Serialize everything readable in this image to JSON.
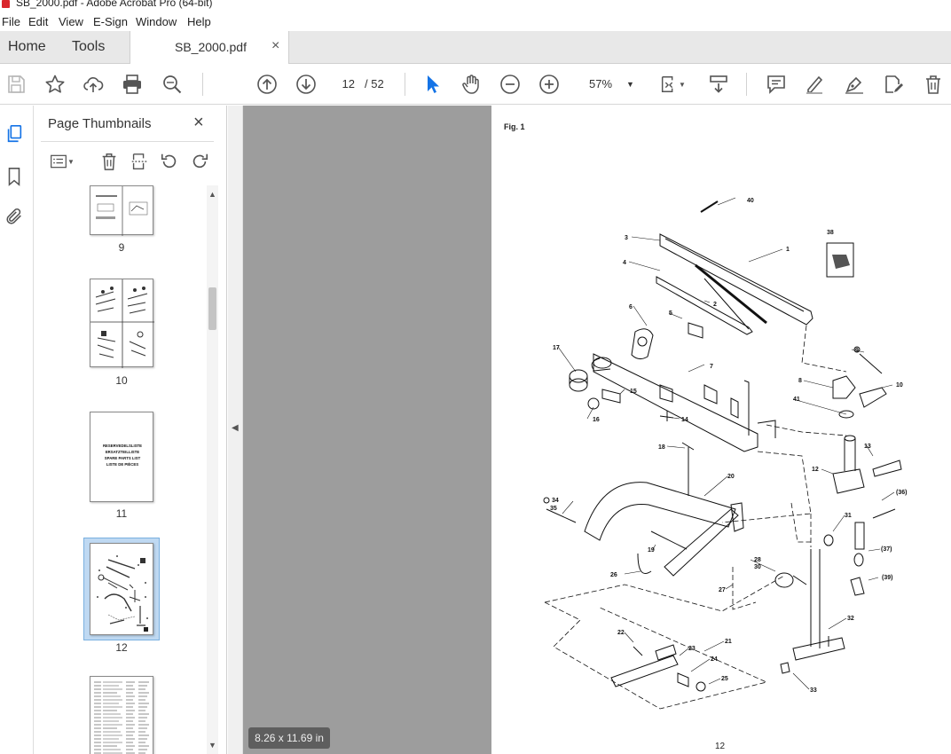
{
  "window": {
    "title": "SB_2000.pdf - Adobe Acrobat Pro (64-bit)"
  },
  "menu": [
    "File",
    "Edit",
    "View",
    "E-Sign",
    "Window",
    "Help"
  ],
  "tabs": {
    "home": "Home",
    "tools": "Tools",
    "document": "SB_2000.pdf",
    "close": "×"
  },
  "toolbar": {
    "current_page": "12",
    "page_total": "/  52",
    "zoom": "57%"
  },
  "thumbnails": {
    "panel_title": "Page Thumbnails",
    "close": "×",
    "pages": [
      {
        "label": "9"
      },
      {
        "label": "10"
      },
      {
        "label": "11",
        "lines": [
          "RESERVEDELSLISTE",
          "ERSATZTEILLISTE",
          "SPARE PARTS LIST",
          "LISTE DE PIÈCES"
        ]
      },
      {
        "label": "12",
        "selected": true
      },
      {
        "label": ""
      }
    ]
  },
  "status": {
    "page_size": "8.26 x 11.69 in"
  },
  "document": {
    "figure_label": "Fig. 1",
    "page_number": "12",
    "callouts": [
      "40",
      "3",
      "1",
      "38",
      "4",
      "2",
      "6",
      "5",
      "17",
      "7",
      "9",
      "10",
      "8",
      "15",
      "41",
      "16",
      "14",
      "13",
      "18",
      "12",
      "20",
      "34",
      "35",
      "(36)",
      "31",
      "19",
      "(37)",
      "28",
      "30",
      "26",
      "27",
      "(39)",
      "32",
      "22",
      "21",
      "23",
      "24",
      "25",
      "33"
    ]
  },
  "colors": {
    "accent": "#1473e6",
    "canvas": "#9d9d9d",
    "selection": "#bfd9f2"
  }
}
